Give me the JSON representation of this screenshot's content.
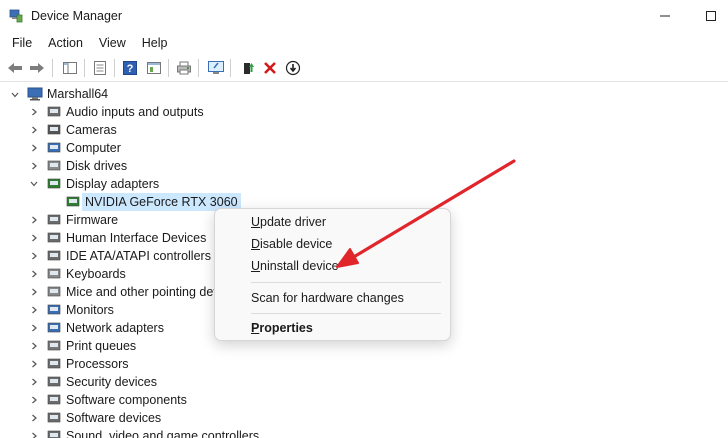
{
  "window": {
    "title": "Device Manager",
    "icon": "device-manager-icon"
  },
  "menu": [
    "File",
    "Action",
    "View",
    "Help"
  ],
  "toolbar": {
    "buttons": [
      "back-icon",
      "forward-icon",
      "show-hide-tree-icon",
      "properties-icon",
      "help-icon",
      "details-view-icon",
      "print-icon",
      "scan-hardware-icon",
      "update-driver-icon",
      "uninstall-icon",
      "disable-icon"
    ]
  },
  "tree": {
    "root": "Marshall64",
    "nodes": [
      {
        "label": "Audio inputs and outputs",
        "icon": "speaker-icon"
      },
      {
        "label": "Cameras",
        "icon": "camera-icon"
      },
      {
        "label": "Computer",
        "icon": "computer-icon"
      },
      {
        "label": "Disk drives",
        "icon": "disk-drive-icon"
      },
      {
        "label": "Display adapters",
        "icon": "display-adapter-icon",
        "expanded": true
      },
      {
        "label": "NVIDIA GeForce RTX 3060",
        "icon": "gpu-icon",
        "child": true,
        "selected": true
      },
      {
        "label": "Firmware",
        "icon": "firmware-icon"
      },
      {
        "label": "Human Interface Devices",
        "icon": "hid-icon"
      },
      {
        "label": "IDE ATA/ATAPI controllers",
        "icon": "ide-controller-icon"
      },
      {
        "label": "Keyboards",
        "icon": "keyboard-icon"
      },
      {
        "label": "Mice and other pointing dev",
        "icon": "mouse-icon"
      },
      {
        "label": "Monitors",
        "icon": "monitor-icon"
      },
      {
        "label": "Network adapters",
        "icon": "network-adapter-icon"
      },
      {
        "label": "Print queues",
        "icon": "printer-icon"
      },
      {
        "label": "Processors",
        "icon": "processor-icon"
      },
      {
        "label": "Security devices",
        "icon": "security-device-icon"
      },
      {
        "label": "Software components",
        "icon": "software-component-icon"
      },
      {
        "label": "Software devices",
        "icon": "software-device-icon"
      },
      {
        "label": "Sound, video and game controllers",
        "icon": "sound-controller-icon"
      }
    ]
  },
  "context_menu": {
    "items": [
      {
        "label": "Update driver"
      },
      {
        "label": "Disable device"
      },
      {
        "label": "Uninstall device"
      },
      {
        "label": "Scan for hardware changes"
      },
      {
        "label": "Properties"
      }
    ]
  },
  "colors": {
    "arrow": "#e0262b",
    "selection": "#cce8ff",
    "accent": "#2f7d32"
  }
}
